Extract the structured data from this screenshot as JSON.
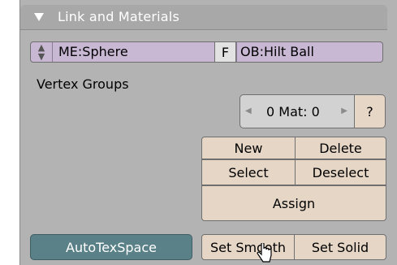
{
  "panel": {
    "title": "Link and Materials",
    "collapse_icon": "triangle-down-icon"
  },
  "mesh": {
    "selector_icon": "up-down-arrows-icon",
    "name": "ME:Sphere",
    "fake_user_label": "F",
    "object_name": "OB:Hilt Ball"
  },
  "vertex_groups": {
    "label": "Vertex Groups"
  },
  "material": {
    "label": "0 Mat: 0",
    "left_arrow_icon": "arrow-left-icon",
    "right_arrow_icon": "arrow-right-icon",
    "query_label": "?"
  },
  "buttons": {
    "new": "New",
    "delete": "Delete",
    "select": "Select",
    "deselect": "Deselect",
    "assign": "Assign",
    "autotexspace": "AutoTexSpace",
    "set_smooth": "Set Smooth",
    "set_solid": "Set Solid"
  },
  "colors": {
    "panel_bg": "#b3b3b3",
    "header_bg": "#a8a8a8",
    "id_field": "#c8b8d4",
    "button": "#e6d6c6",
    "toggle_on": "#5a8188"
  }
}
